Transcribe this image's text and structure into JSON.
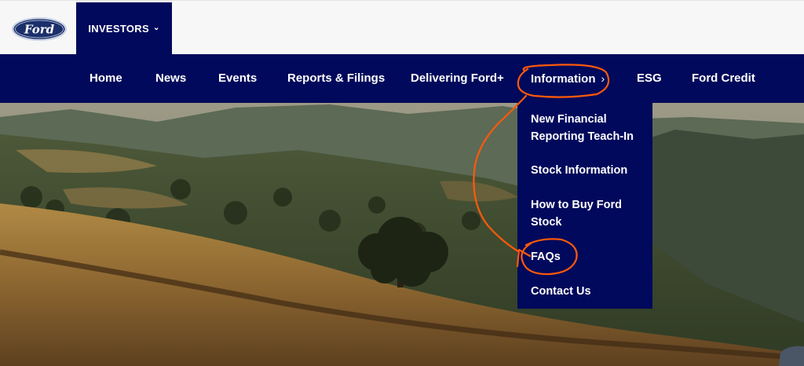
{
  "brand": {
    "logo_text": "Ford"
  },
  "header": {
    "investors_label": "INVESTORS"
  },
  "nav": {
    "items": [
      {
        "label": "Home"
      },
      {
        "label": "News"
      },
      {
        "label": "Events"
      },
      {
        "label": "Reports & Filings"
      },
      {
        "label": "Delivering Ford+"
      },
      {
        "label": "Information"
      },
      {
        "label": "ESG"
      },
      {
        "label": "Ford Credit"
      }
    ]
  },
  "dropdown": {
    "items": [
      {
        "label": "New Financial Reporting Teach-In"
      },
      {
        "label": "Stock Information"
      },
      {
        "label": "How to Buy Ford Stock"
      },
      {
        "label": "FAQs"
      },
      {
        "label": "Contact Us"
      }
    ]
  },
  "colors": {
    "brand_navy": "#00095b",
    "annotation": "#ff5a0a",
    "topbar_bg": "#f7f7f7"
  },
  "icons": {
    "investors_chevron": "chevron-down-icon",
    "information_chevron": "chevron-right-icon"
  }
}
